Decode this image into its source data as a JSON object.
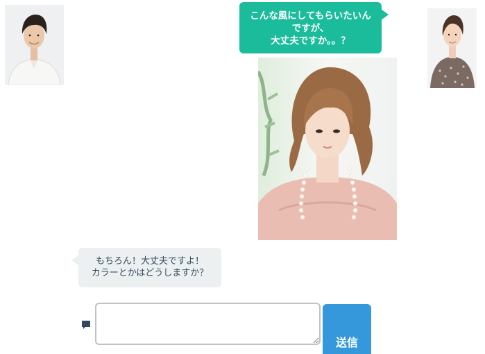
{
  "avatars": {
    "left_icon": "male-user-avatar",
    "right_icon": "female-user-avatar"
  },
  "messages": [
    {
      "sender": "self",
      "lines": [
        "こんな風にしてもらいたいん",
        "ですが、",
        "大丈夫ですか。。？"
      ],
      "attachment_icon": "hairstyle-photo"
    },
    {
      "sender": "other",
      "lines": [
        "もちろん！大丈夫ですよ！",
        "カラーとかはどうしますか？"
      ]
    }
  ],
  "composer": {
    "icon": "comment-icon",
    "value": "",
    "placeholder": "",
    "send_label": "送信"
  },
  "colors": {
    "self_bubble": "#1abc9c",
    "other_bubble": "#ecf0f1",
    "send_button": "#3498db",
    "input_border": "#bdc3c7"
  }
}
